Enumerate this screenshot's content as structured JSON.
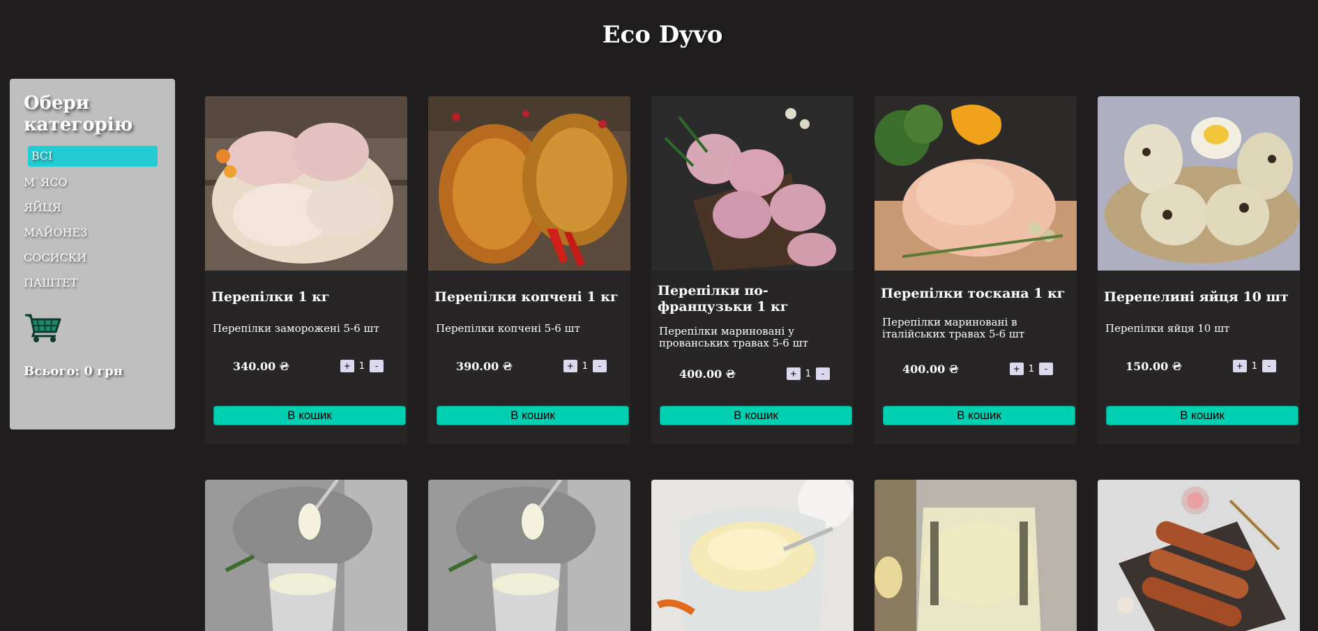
{
  "site": {
    "title": "Eco Dyvo"
  },
  "sidebar": {
    "title": "Обери категорію",
    "categories": [
      {
        "label": "ВСІ",
        "active": true
      },
      {
        "label": "М`ЯСО"
      },
      {
        "label": "ЯЙЦЯ"
      },
      {
        "label": "МАЙОНЕЗ"
      },
      {
        "label": "СОСИСКИ"
      },
      {
        "label": "ПАШТЕТ"
      }
    ],
    "cart_icon": "shopping-cart-icon",
    "total": "Всього: 0 грн"
  },
  "colors": {
    "background": "#201e1f",
    "card": "#272526",
    "accent": "#00cfb2",
    "active_category": "#22ccd2",
    "sidebar": "#bfbfbf"
  },
  "products": [
    {
      "name": "Перепілки 1 кг",
      "desc": "Перепілки заморожені 5-6 шт",
      "price": "340.00 ₴",
      "qty": "1",
      "buy": "В кошик",
      "plus": "+",
      "minus": "-"
    },
    {
      "name": "Перепілки копчені 1 кг",
      "desc": "Перепілки копчені 5-6 шт",
      "price": "390.00 ₴",
      "qty": "1",
      "buy": "В кошик",
      "plus": "+",
      "minus": "-"
    },
    {
      "name": "Перепілки по-французьки 1 кг",
      "desc": "Перепілки мариновані у прованських травах 5-6 шт",
      "price": "400.00 ₴",
      "qty": "1",
      "buy": "В кошик",
      "plus": "+",
      "minus": "-"
    },
    {
      "name": "Перепілки тоскана 1 кг",
      "desc": "Перепілки мариновані в італійських травах 5-6 шт",
      "price": "400.00 ₴",
      "qty": "1",
      "buy": "В кошик",
      "plus": "+",
      "minus": "-"
    },
    {
      "name": "Перепелині яйця 10 шт",
      "desc": "Перепілки яйця 10 шт",
      "price": "150.00 ₴",
      "qty": "1",
      "buy": "В кошик",
      "plus": "+",
      "minus": "-"
    }
  ]
}
